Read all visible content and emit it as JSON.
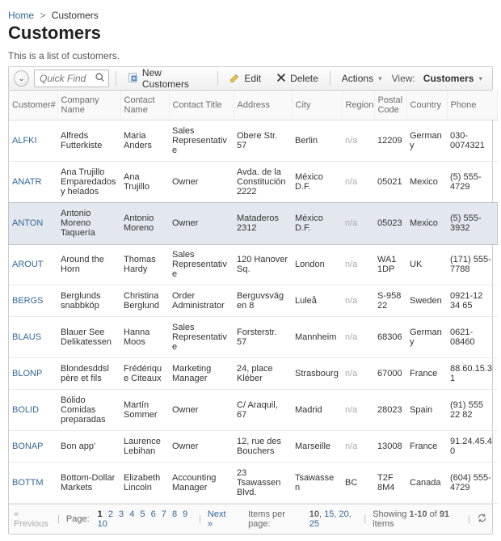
{
  "breadcrumb": {
    "home": "Home",
    "current": "Customers"
  },
  "title": "Customers",
  "description": "This is a list of customers.",
  "toolbar": {
    "quick_find_placeholder": "Quick Find",
    "new_label": "New Customers",
    "edit_label": "Edit",
    "delete_label": "Delete",
    "actions_label": "Actions",
    "view_label": "View:",
    "view_value": "Customers"
  },
  "columns": {
    "id": "Customer#",
    "company": "Company Name",
    "contact_name": "Contact Name",
    "contact_title": "Contact Title",
    "address": "Address",
    "city": "City",
    "region": "Region",
    "postal": "Postal Code",
    "country": "Country",
    "phone": "Phone"
  },
  "rows": [
    {
      "id": "ALFKI",
      "company": "Alfreds Futterkiste",
      "contact_name": "Maria Anders",
      "contact_title": "Sales Representative",
      "address": "Obere Str. 57",
      "city": "Berlin",
      "region": "n/a",
      "postal": "12209",
      "country": "Germany",
      "phone": "030-0074321",
      "selected": false
    },
    {
      "id": "ANATR",
      "company": "Ana Trujillo Emparedados y helados",
      "contact_name": "Ana Trujillo",
      "contact_title": "Owner",
      "address": "Avda. de la Constitución 2222",
      "city": "México D.F.",
      "region": "n/a",
      "postal": "05021",
      "country": "Mexico",
      "phone": "(5) 555-4729",
      "selected": false
    },
    {
      "id": "ANTON",
      "company": "Antonio Moreno Taquería",
      "contact_name": "Antonio Moreno",
      "contact_title": "Owner",
      "address": "Mataderos 2312",
      "city": "México D.F.",
      "region": "n/a",
      "postal": "05023",
      "country": "Mexico",
      "phone": "(5) 555-3932",
      "selected": true
    },
    {
      "id": "AROUT",
      "company": "Around the Horn",
      "contact_name": "Thomas Hardy",
      "contact_title": "Sales Representative",
      "address": "120 Hanover Sq.",
      "city": "London",
      "region": "n/a",
      "postal": "WA1 1DP",
      "country": "UK",
      "phone": "(171) 555-7788",
      "selected": false
    },
    {
      "id": "BERGS",
      "company": "Berglunds snabbköp",
      "contact_name": "Christina Berglund",
      "contact_title": "Order Administrator",
      "address": "Berguvsvägen 8",
      "city": "Luleå",
      "region": "n/a",
      "postal": "S-958 22",
      "country": "Sweden",
      "phone": "0921-12 34 65",
      "selected": false
    },
    {
      "id": "BLAUS",
      "company": "Blauer See Delikatessen",
      "contact_name": "Hanna Moos",
      "contact_title": "Sales Representative",
      "address": "Forsterstr. 57",
      "city": "Mannheim",
      "region": "n/a",
      "postal": "68306",
      "country": "Germany",
      "phone": "0621-08460",
      "selected": false
    },
    {
      "id": "BLONP",
      "company": "Blondesddsl père et fils",
      "contact_name": "Frédérique Citeaux",
      "contact_title": "Marketing Manager",
      "address": "24, place Kléber",
      "city": "Strasbourg",
      "region": "n/a",
      "postal": "67000",
      "country": "France",
      "phone": "88.60.15.31",
      "selected": false
    },
    {
      "id": "BOLID",
      "company": "Bólido Comidas preparadas",
      "contact_name": "Martín Sommer",
      "contact_title": "Owner",
      "address": "C/ Araquil, 67",
      "city": "Madrid",
      "region": "n/a",
      "postal": "28023",
      "country": "Spain",
      "phone": "(91) 555 22 82",
      "selected": false
    },
    {
      "id": "BONAP",
      "company": "Bon app'",
      "contact_name": "Laurence Lebihan",
      "contact_title": "Owner",
      "address": "12, rue des Bouchers",
      "city": "Marseille",
      "region": "n/a",
      "postal": "13008",
      "country": "France",
      "phone": "91.24.45.40",
      "selected": false
    },
    {
      "id": "BOTTM",
      "company": "Bottom-Dollar Markets",
      "contact_name": "Elizabeth Lincoln",
      "contact_title": "Accounting Manager",
      "address": "23 Tsawassen Blvd.",
      "city": "Tsawassen",
      "region": "BC",
      "postal": "T2F 8M4",
      "country": "Canada",
      "phone": "(604) 555-4729",
      "selected": false
    }
  ],
  "footer": {
    "prev": "« Previous",
    "page_label": "Page:",
    "pages": [
      "1",
      "2",
      "3",
      "4",
      "5",
      "6",
      "7",
      "8",
      "9",
      "10"
    ],
    "current_page": "1",
    "next": "Next »",
    "ipp_label": "Items per page:",
    "ipp_options": [
      "10",
      "15",
      "20",
      "25"
    ],
    "ipp_current": "10",
    "showing_prefix": "Showing ",
    "showing_range": "1-10",
    "showing_mid": " of ",
    "showing_total": "91",
    "showing_suffix": " items"
  }
}
